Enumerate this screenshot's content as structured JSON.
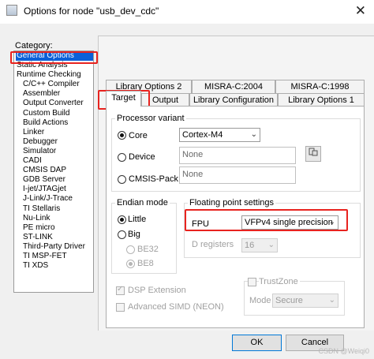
{
  "window": {
    "title": "Options for node \"usb_dev_cdc\"",
    "close_glyph": "✕"
  },
  "category": {
    "label": "Category:",
    "items": [
      {
        "label": "General Options",
        "indent": false,
        "selected": true
      },
      {
        "label": "Static Analysis",
        "indent": false
      },
      {
        "label": "Runtime Checking",
        "indent": false
      },
      {
        "label": "C/C++ Compiler",
        "indent": true
      },
      {
        "label": "Assembler",
        "indent": true
      },
      {
        "label": "Output Converter",
        "indent": true
      },
      {
        "label": "Custom Build",
        "indent": true
      },
      {
        "label": "Build Actions",
        "indent": true
      },
      {
        "label": "Linker",
        "indent": true
      },
      {
        "label": "Debugger",
        "indent": true
      },
      {
        "label": "Simulator",
        "indent": true
      },
      {
        "label": "CADI",
        "indent": true
      },
      {
        "label": "CMSIS DAP",
        "indent": true
      },
      {
        "label": "GDB Server",
        "indent": true
      },
      {
        "label": "I-jet/JTAGjet",
        "indent": true
      },
      {
        "label": "J-Link/J-Trace",
        "indent": true
      },
      {
        "label": "TI Stellaris",
        "indent": true
      },
      {
        "label": "Nu-Link",
        "indent": true
      },
      {
        "label": "PE micro",
        "indent": true
      },
      {
        "label": "ST-LINK",
        "indent": true
      },
      {
        "label": "Third-Party Driver",
        "indent": true
      },
      {
        "label": "TI MSP-FET",
        "indent": true
      },
      {
        "label": "TI XDS",
        "indent": true
      }
    ]
  },
  "tabs": {
    "row_back": [
      "Library Options 2",
      "MISRA-C:2004",
      "MISRA-C:1998"
    ],
    "row_front": [
      "Target",
      "Output",
      "Library Configuration",
      "Library Options 1"
    ],
    "active": "Target"
  },
  "processor": {
    "title": "Processor variant",
    "core_label": "Core",
    "core_value": "Cortex-M4",
    "device_label": "Device",
    "device_value": "None",
    "cmsis_label": "CMSIS-Pack",
    "cmsis_value": "None"
  },
  "endian": {
    "title": "Endian mode",
    "little": "Little",
    "big": "Big",
    "be32": "BE32",
    "be8": "BE8"
  },
  "fpu": {
    "title": "Floating point settings",
    "fpu_label": "FPU",
    "fpu_value": "VFPv4 single precision",
    "dreg_label": "D registers",
    "dreg_value": "16"
  },
  "extensions": {
    "dsp": "DSP Extension",
    "simd": "Advanced SIMD (NEON)"
  },
  "trustzone": {
    "label": "TrustZone",
    "mode_label": "Mode",
    "mode_value": "Secure"
  },
  "buttons": {
    "ok": "OK",
    "cancel": "Cancel"
  },
  "watermark": "CSDN @Weiqi0",
  "colors": {
    "highlight": "#e8231f",
    "selection": "#0a60d8"
  }
}
